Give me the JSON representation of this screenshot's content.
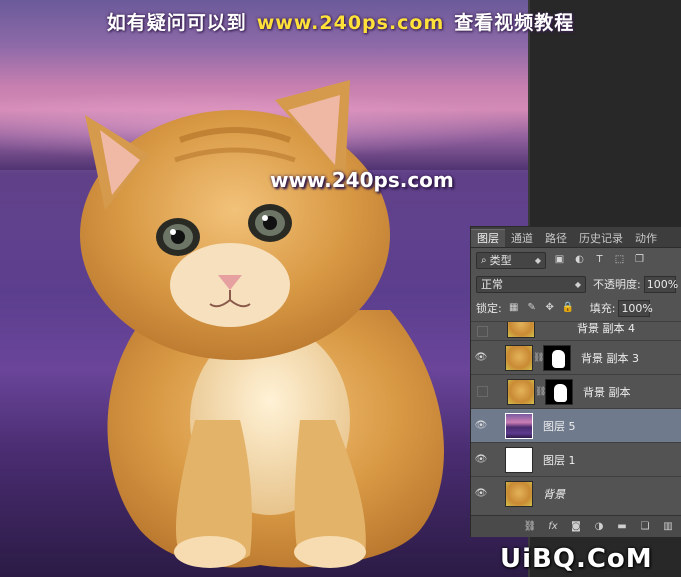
{
  "watermark": {
    "top_left": "如有疑问可以到",
    "top_site": "www.240ps.com",
    "top_right": "查看视频教程",
    "mid": "www.240ps.com",
    "bottom": "UiBQ.CoM"
  },
  "layers_panel": {
    "tabs": [
      "图层",
      "通道",
      "路径",
      "历史记录",
      "动作"
    ],
    "filter_kind": "类型",
    "blend_mode": "正常",
    "opacity_label": "不透明度:",
    "opacity_value": "100%",
    "lock_label": "锁定:",
    "fill_label": "填充:",
    "fill_value": "100%",
    "layers": [
      {
        "name": "背景 副本 4",
        "visible": false,
        "thumb": "cat",
        "mask": false
      },
      {
        "name": "背景 副本 3",
        "visible": true,
        "thumb": "cat",
        "mask": true
      },
      {
        "name": "背景 副本",
        "visible": false,
        "thumb": "cat",
        "mask": true
      },
      {
        "name": "图层 5",
        "visible": true,
        "thumb": "purple",
        "mask": false,
        "selected": true
      },
      {
        "name": "图层 1",
        "visible": true,
        "thumb": "white",
        "mask": false
      },
      {
        "name": "背景",
        "visible": true,
        "thumb": "cat",
        "mask": false
      }
    ]
  },
  "colors": {
    "panel_bg": "#535353",
    "selected_layer": "#6f7a8c",
    "watermark_site": "#ffe13a"
  }
}
